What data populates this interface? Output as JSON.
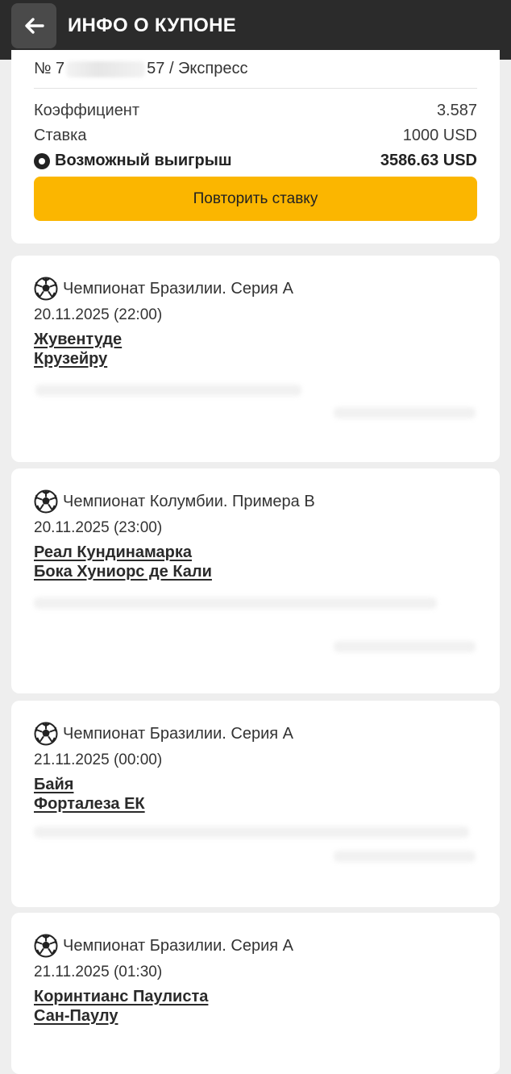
{
  "header": {
    "title": "ИНФО О КУПОНЕ"
  },
  "summary": {
    "coupon_prefix": "№ 7",
    "coupon_suffix": "57 / Экспресс",
    "rows": [
      {
        "label": "Коэффициент",
        "value": "3.587"
      },
      {
        "label": "Ставка",
        "value": "1000 USD"
      },
      {
        "label": "Возможный выигрыш",
        "value": "3586.63 USD"
      }
    ],
    "repeat_button": "Повторить ставку"
  },
  "events": [
    {
      "league": "Чемпионат Бразилии. Серия А",
      "date": "20.11.2025 (22:00)",
      "home": "Жувентуде",
      "away": "Крузейру"
    },
    {
      "league": "Чемпионат Колумбии. Примера B",
      "date": "20.11.2025 (23:00)",
      "home": "Реал Кундинамарка",
      "away": "Бока Хуниорс де Кали"
    },
    {
      "league": "Чемпионат Бразилии. Серия А",
      "date": "21.11.2025 (00:00)",
      "home": "Байя",
      "away": "Форталеза ЕК"
    },
    {
      "league": "Чемпионат Бразилии. Серия А",
      "date": "21.11.2025 (01:30)",
      "home": "Коринтианс Паулиста",
      "away": "Сан-Паулу"
    }
  ],
  "colors": {
    "accent": "#fbb600",
    "topbar": "#2b2b2b"
  }
}
